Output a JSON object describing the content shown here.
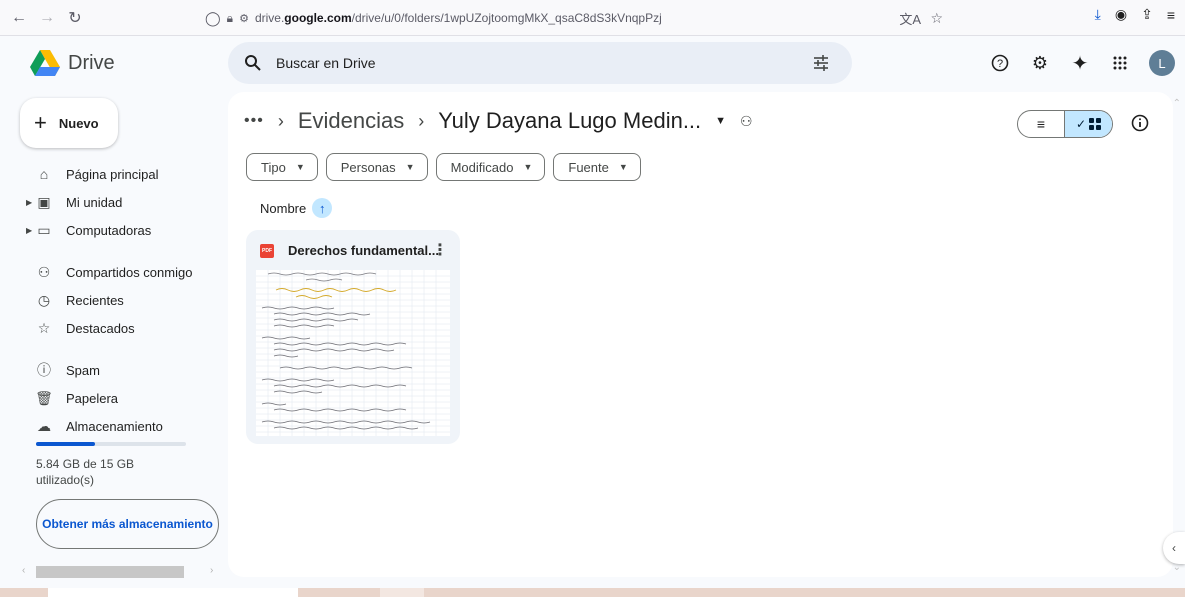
{
  "browser": {
    "url_prefix": "drive.",
    "url_domain": "google.com",
    "url_path": "/drive/u/0/folders/1wpUZojtoomgMkX_qsaC8dS3kVnqpPzj"
  },
  "header": {
    "app_name": "Drive",
    "search_placeholder": "Buscar en Drive",
    "avatar_letter": "L"
  },
  "sidebar": {
    "new_label": "Nuevo",
    "items": [
      {
        "label": "Página principal",
        "icon": "home-icon"
      },
      {
        "label": "Mi unidad",
        "icon": "my-drive-icon"
      },
      {
        "label": "Computadoras",
        "icon": "computer-icon"
      },
      {
        "label": "Compartidos conmigo",
        "icon": "shared-icon"
      },
      {
        "label": "Recientes",
        "icon": "clock-icon"
      },
      {
        "label": "Destacados",
        "icon": "star-icon"
      },
      {
        "label": "Spam",
        "icon": "spam-icon"
      },
      {
        "label": "Papelera",
        "icon": "trash-icon"
      },
      {
        "label": "Almacenamiento",
        "icon": "cloud-icon"
      }
    ],
    "storage_used_fraction": 0.39,
    "storage_text": "5.84 GB de 15 GB utilizado(s)",
    "more_storage_label": "Obtener más almacenamiento"
  },
  "main": {
    "breadcrumb": {
      "more": "•••",
      "parent": "Evidencias",
      "current": "Yuly Dayana Lugo Medin..."
    },
    "filters": [
      "Tipo",
      "Personas",
      "Modificado",
      "Fuente"
    ],
    "sort_label": "Nombre",
    "files": [
      {
        "name": "Derechos fundamental...",
        "type": "PDF"
      }
    ]
  },
  "colors": {
    "accent": "#0b57d0",
    "selected_bg": "#c2e7ff",
    "pdf_red": "#ea4335"
  }
}
